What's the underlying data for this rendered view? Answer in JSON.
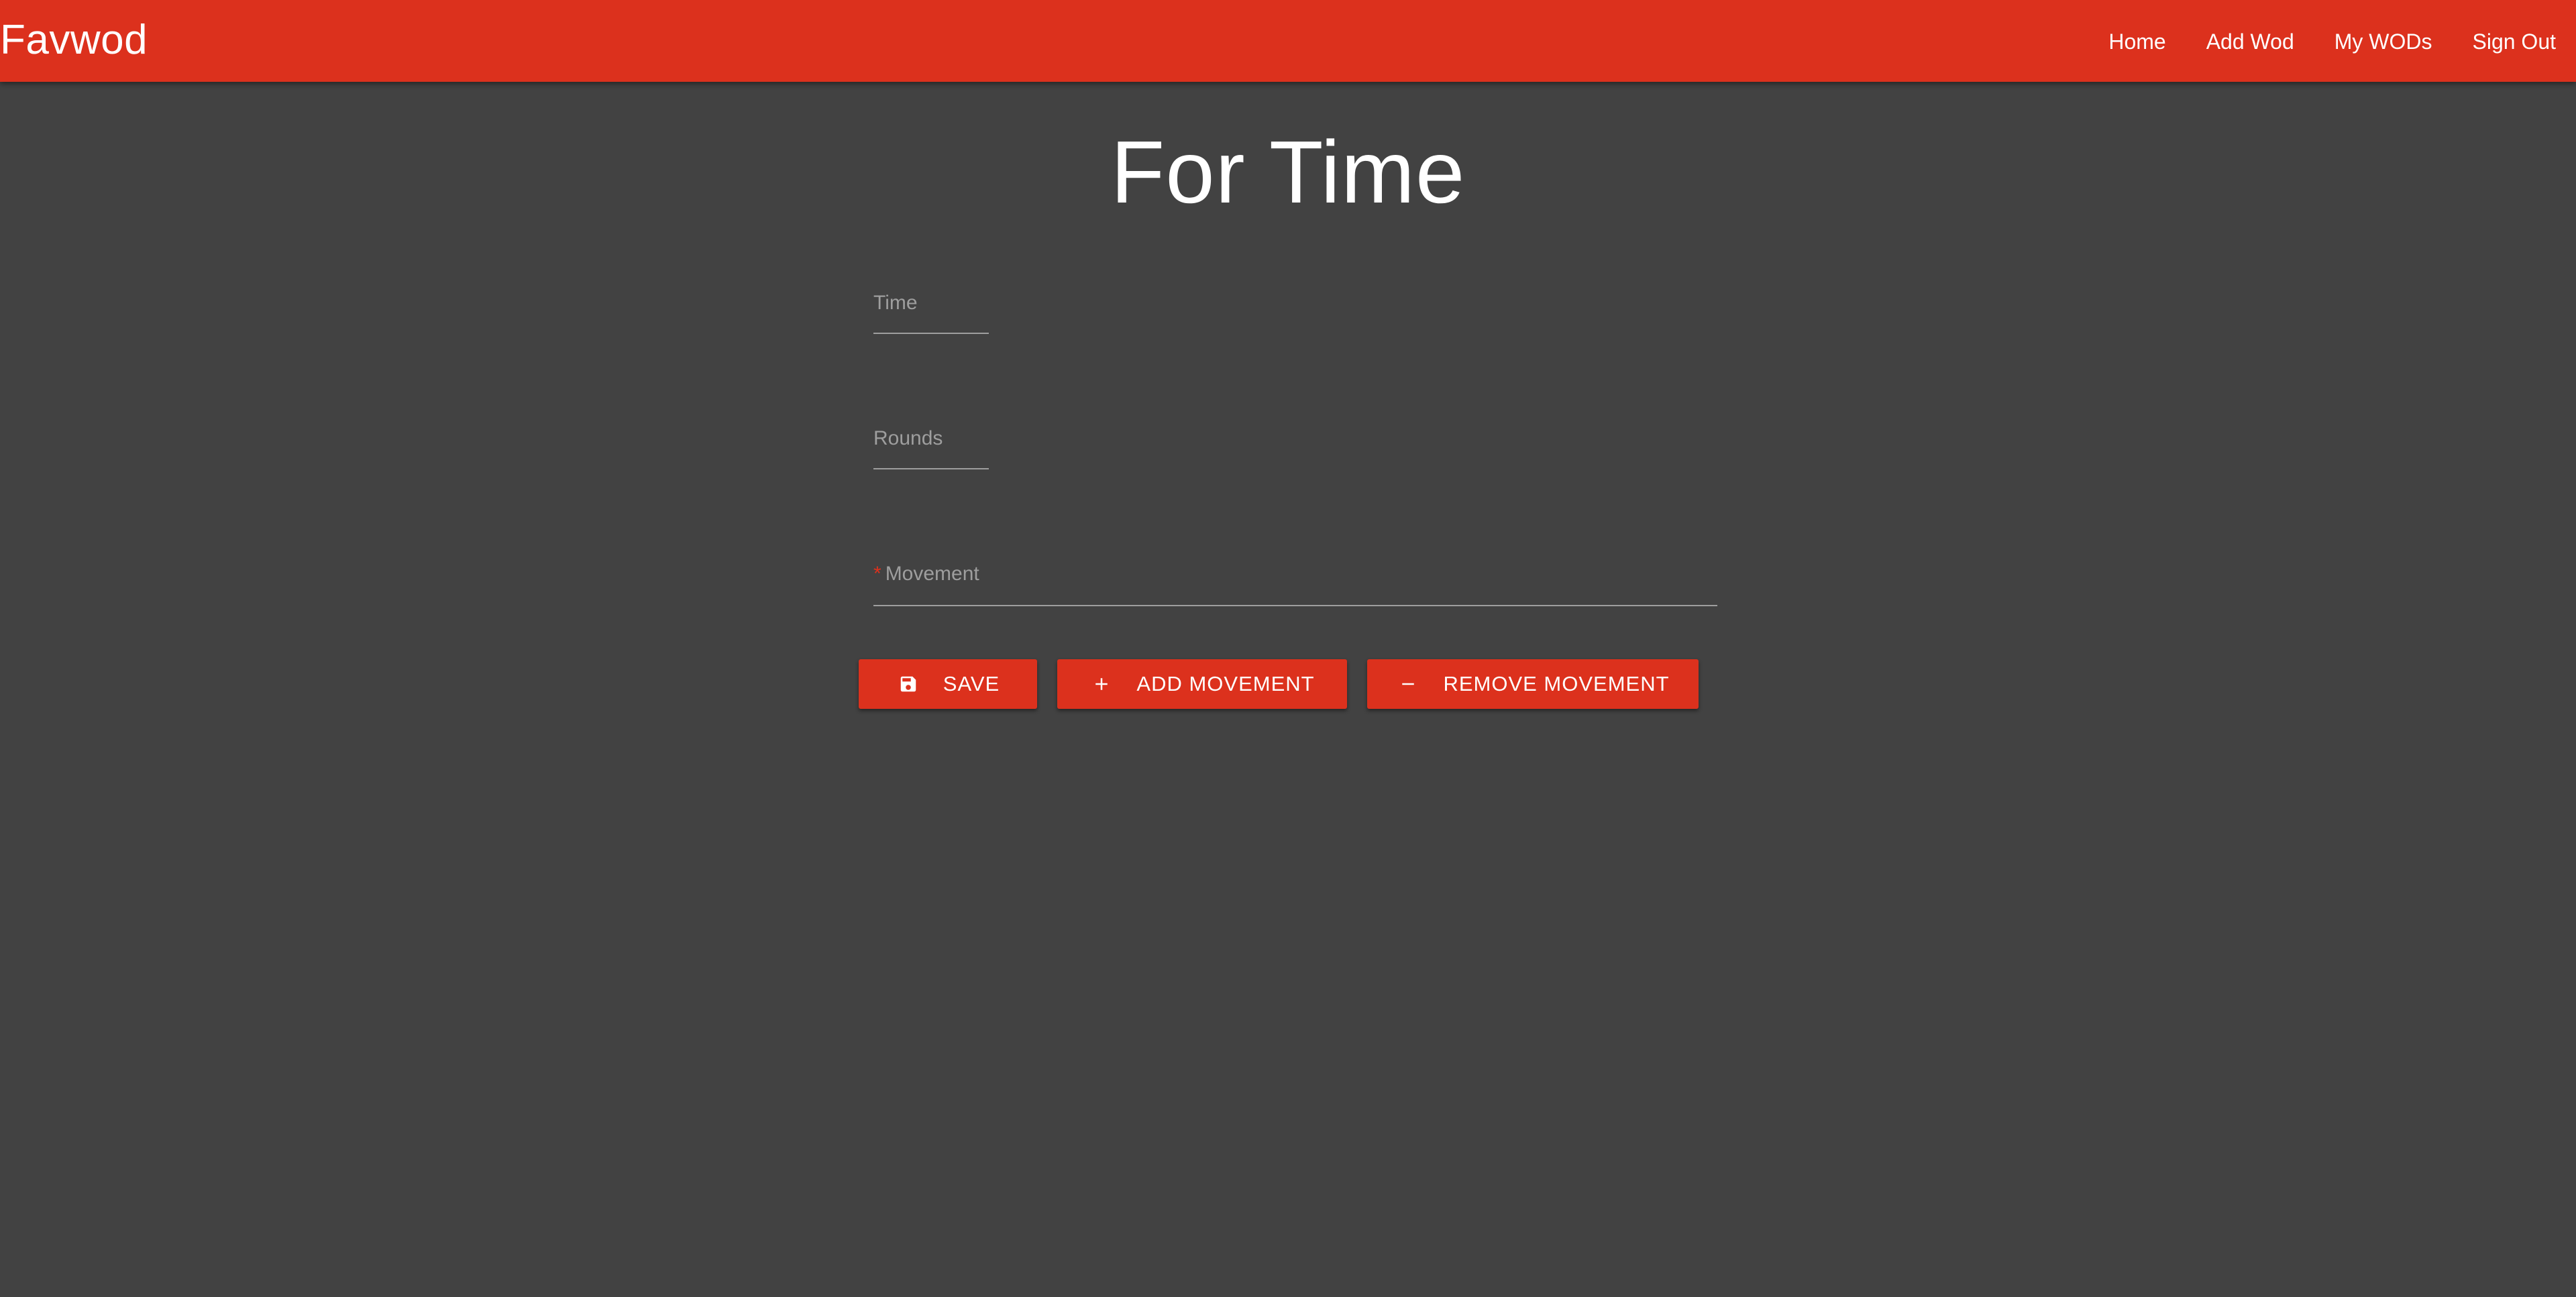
{
  "app": {
    "brand": "Favwod",
    "nav": [
      {
        "label": "Home"
      },
      {
        "label": "Add Wod"
      },
      {
        "label": "My WODs"
      },
      {
        "label": "Sign Out"
      }
    ]
  },
  "page": {
    "title": "For Time"
  },
  "form": {
    "time": {
      "label": "Time",
      "value": ""
    },
    "rounds": {
      "label": "Rounds",
      "value": ""
    },
    "movement": {
      "required_mark": "*",
      "label": "Movement",
      "value": ""
    }
  },
  "actions": {
    "save": {
      "label": "SAVE",
      "icon": "floppy-disk-icon"
    },
    "add": {
      "label": "ADD MOVEMENT",
      "icon": "plus-icon"
    },
    "remove": {
      "label": "REMOVE MOVEMENT",
      "icon": "minus-icon"
    }
  },
  "colors": {
    "primary": "#dc311d",
    "background": "#424242",
    "muted_text": "#9e9e9e"
  }
}
